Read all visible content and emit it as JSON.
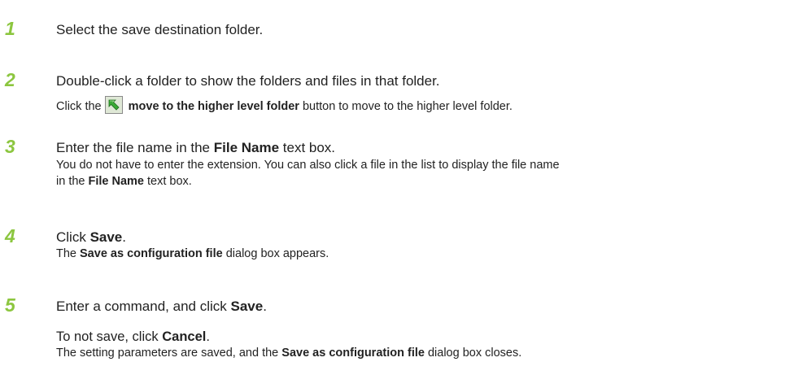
{
  "steps": [
    {
      "number": "1",
      "main": [
        "Select the save destination folder."
      ]
    },
    {
      "number": "2",
      "main": [
        "Double-click a folder to show the folders and files in that folder."
      ],
      "sub_pre": "Click the",
      "sub_bold": "move to the higher level folder",
      "sub_post": "button to move to the higher level folder.",
      "icon": "up-arrow-folder-icon"
    },
    {
      "number": "3",
      "main_pre": "Enter the file name in the ",
      "main_bold": "File Name",
      "main_post": " text box.",
      "sub_line1": "You do not have to enter the extension. You can also click a file in the list to display the file name",
      "sub_line2_pre": "in the ",
      "sub_line2_bold": "File Name",
      "sub_line2_post": " text box."
    },
    {
      "number": "4",
      "main_pre": "Click ",
      "main_bold": "Save",
      "main_post": ".",
      "sub_pre": "The ",
      "sub_bold": "Save as configuration file",
      "sub_post": " dialog box appears."
    },
    {
      "number": "5",
      "main_pre": "Enter a command, and click ",
      "main_bold": "Save",
      "main_post": ".",
      "main2_pre": "To not save, click ",
      "main2_bold": "Cancel",
      "main2_post": ".",
      "sub_pre": "The setting parameters are saved, and the ",
      "sub_bold": "Save as configuration file",
      "sub_post": " dialog box closes."
    }
  ],
  "colors": {
    "step_number": "#8cc63f",
    "text": "#222222",
    "icon_arrow": "#3aa935"
  }
}
